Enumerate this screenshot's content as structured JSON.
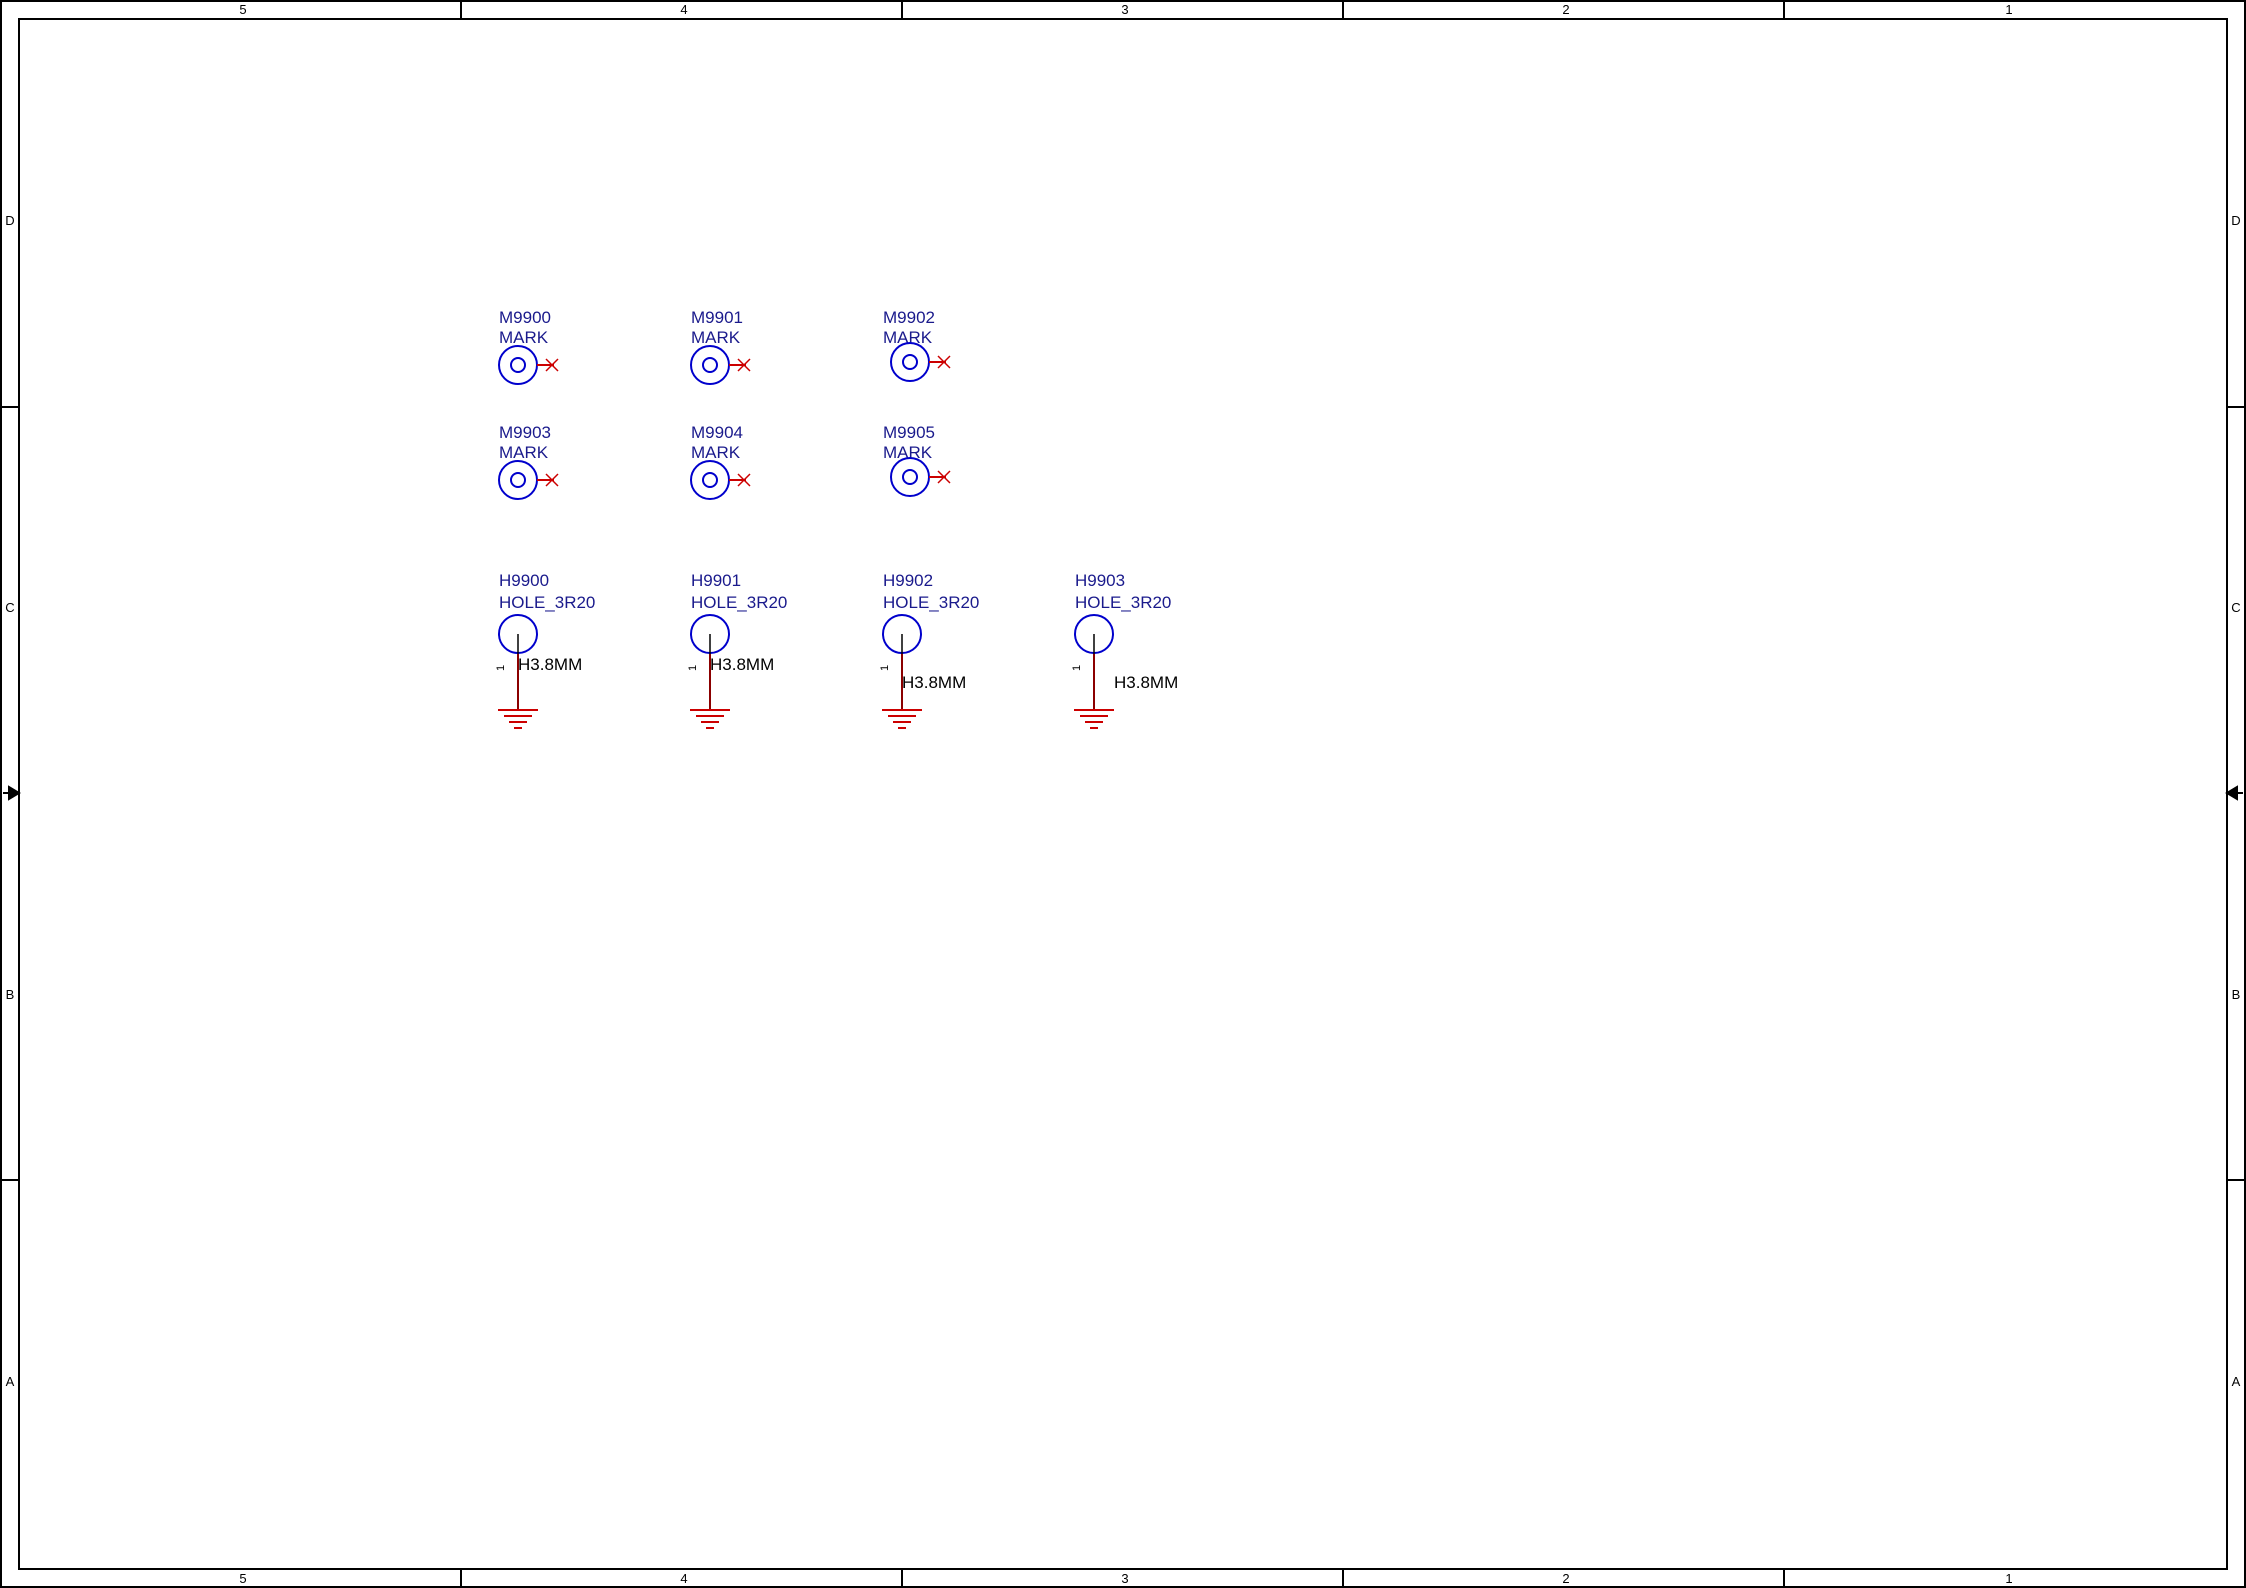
{
  "sheet": {
    "columns": [
      "5",
      "4",
      "3",
      "2",
      "1"
    ],
    "rows": [
      "D",
      "C",
      "B",
      "A"
    ],
    "colors": {
      "border": "#000000",
      "symbol": "#0000cc",
      "wire": "#cc0000",
      "text": "#1a1a8c"
    }
  },
  "marks": [
    {
      "ref": "M9900",
      "value": "MARK",
      "icon": "fiducial-mark-icon"
    },
    {
      "ref": "M9901",
      "value": "MARK",
      "icon": "fiducial-mark-icon"
    },
    {
      "ref": "M9902",
      "value": "MARK",
      "icon": "fiducial-mark-icon"
    },
    {
      "ref": "M9903",
      "value": "MARK",
      "icon": "fiducial-mark-icon"
    },
    {
      "ref": "M9904",
      "value": "MARK",
      "icon": "fiducial-mark-icon"
    },
    {
      "ref": "M9905",
      "value": "MARK",
      "icon": "fiducial-mark-icon"
    }
  ],
  "holes": [
    {
      "ref": "H9900",
      "value": "HOLE_3R20",
      "footprint": "H3.8MM",
      "pin": "1",
      "icon": "mounting-hole-icon"
    },
    {
      "ref": "H9901",
      "value": "HOLE_3R20",
      "footprint": "H3.8MM",
      "pin": "1",
      "icon": "mounting-hole-icon"
    },
    {
      "ref": "H9902",
      "value": "HOLE_3R20",
      "footprint": "H3.8MM",
      "pin": "1",
      "icon": "mounting-hole-icon"
    },
    {
      "ref": "H9903",
      "value": "HOLE_3R20",
      "footprint": "H3.8MM",
      "pin": "1",
      "icon": "mounting-hole-icon"
    }
  ]
}
